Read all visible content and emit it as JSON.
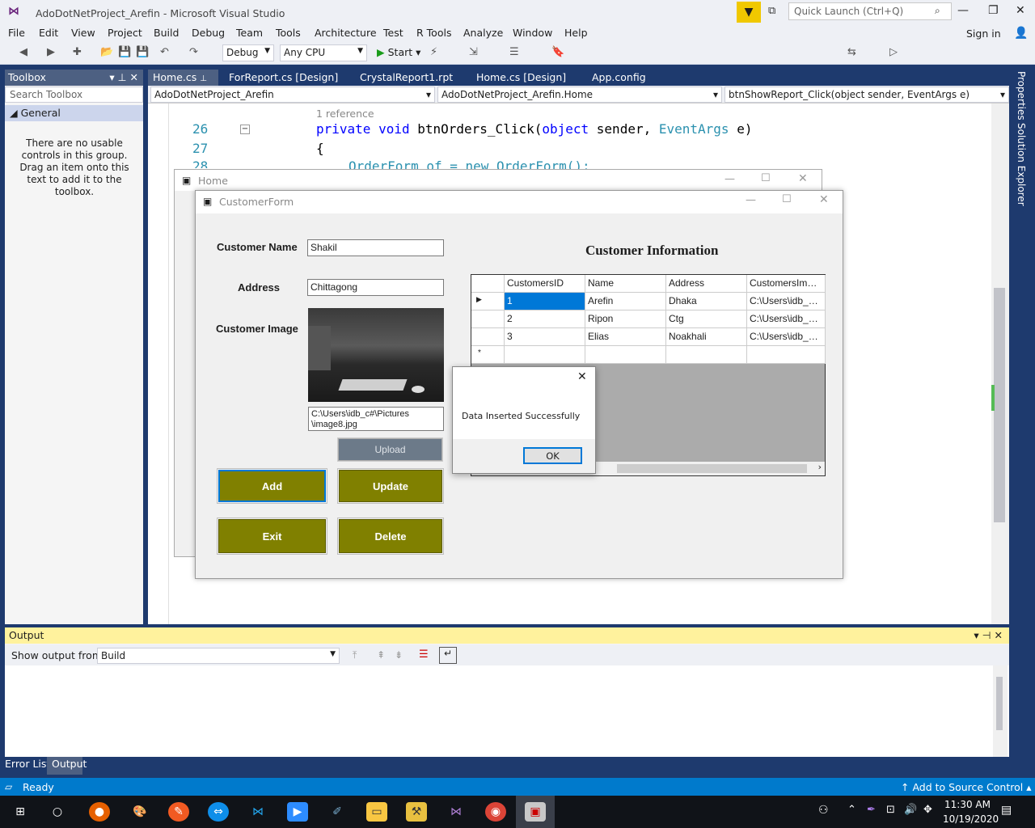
{
  "window": {
    "title": "AdoDotNetProject_Arefin - Microsoft Visual Studio"
  },
  "quick_launch": {
    "placeholder": "Quick Launch (Ctrl+Q)"
  },
  "menu": [
    "File",
    "Edit",
    "View",
    "Project",
    "Build",
    "Debug",
    "Team",
    "Tools",
    "Architecture",
    "Test",
    "R Tools",
    "Analyze",
    "Window",
    "Help"
  ],
  "account": {
    "sign_in": "Sign in"
  },
  "toolbar": {
    "config": "Debug",
    "platform": "Any CPU",
    "start": "Start"
  },
  "toolbox": {
    "title": "Toolbox",
    "search_placeholder": "Search Toolbox",
    "group": "General",
    "empty_message": "There are no usable controls in this group. Drag an item onto this text to add it to the toolbox."
  },
  "tabs": [
    "Home.cs",
    "ForReport.cs [Design]",
    "CrystalReport1.rpt",
    "Home.cs [Design]",
    "App.config"
  ],
  "navbar": {
    "project": "AdoDotNetProject_Arefin",
    "class": "AdoDotNetProject_Arefin.Home",
    "member": "btnShowReport_Click(object sender, EventArgs e)"
  },
  "code": {
    "reference": "1 reference",
    "lines": [
      {
        "num": "26",
        "text_kw": "private void",
        "text_name": " btnOrders_Click(",
        "text_kw2": "object",
        "text_mid": " sender, ",
        "text_ty": "EventArgs",
        "text_end": " e)"
      },
      {
        "num": "27",
        "text": "{"
      },
      {
        "num": "28",
        "text": "OrderForm of = new OrderForm();"
      }
    ]
  },
  "side_tabs": [
    "Properties",
    "Solution Explorer"
  ],
  "output": {
    "title": "Output",
    "show_from_label": "Show output from:",
    "source": "Build"
  },
  "bottom_tabs": [
    "Error List",
    "Output"
  ],
  "status": {
    "ready": "Ready",
    "source_control": "Add to Source Control"
  },
  "clock": {
    "time": "11:30 AM",
    "date": "10/19/2020"
  },
  "home_window": {
    "title": "Home"
  },
  "customer_form": {
    "title": "CustomerForm",
    "name_label": "Customer Name",
    "name_value": "Shakil",
    "address_label": "Address",
    "address_value": "Chittagong",
    "image_label": "Customer Image",
    "image_path_line1": "C:\\Users\\idb_c#\\Pictures",
    "image_path_line2": "\\image8.jpg",
    "upload": "Upload",
    "add": "Add",
    "update": "Update",
    "exit": "Exit",
    "delete": "Delete",
    "grid_title": "Customer Information",
    "columns": [
      "CustomersID",
      "Name",
      "Address",
      "CustomersImage"
    ],
    "rows": [
      [
        "1",
        "Arefin",
        "Dhaka",
        "C:\\Users\\idb_c#..."
      ],
      [
        "2",
        "Ripon",
        "Ctg",
        "C:\\Users\\idb_c#..."
      ],
      [
        "3",
        "Elias",
        "Noakhali",
        "C:\\Users\\idb_c#..."
      ]
    ]
  },
  "message_box": {
    "text": "Data Inserted Successfully",
    "ok": "OK"
  },
  "colors": {
    "olive": "#808000",
    "vs_blue": "#1e3a6e",
    "status_blue": "#007acc",
    "selection": "#0078d7"
  }
}
